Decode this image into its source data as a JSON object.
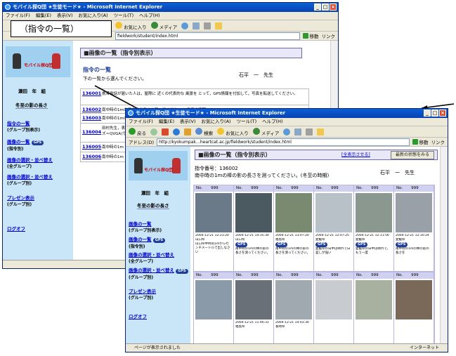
{
  "callout": {
    "label": "（指令の一覧）"
  },
  "back_window": {
    "title": "モバイル探Q団  ★生徒モード★ - Microsoft Internet Explorer",
    "menu": [
      "ファイル(F)",
      "編集(E)",
      "表示(V)",
      "お気に入り(A)",
      "ツール(T)",
      "ヘルプ(H)"
    ],
    "toolbar": {
      "favorites": "お気に入り",
      "media": "メディア"
    },
    "address": {
      "url": "fieldwork/student/index.html",
      "go": "移動",
      "links": "リンク"
    },
    "logo_text": "モバイル探Q団",
    "school": "瀬田　年　組",
    "theme": "冬至の影の長さ",
    "nav": [
      {
        "label": "指令の一覧",
        "sub": "(グループ別表示)",
        "gps": false
      },
      {
        "label": "画像の一覧",
        "sub": "(指令別)",
        "gps": true,
        "gps_label": "GPS"
      },
      {
        "label": "画像の選択・並べ替え",
        "sub": "(全グループ)",
        "gps": false
      },
      {
        "label": "画像の選択・並べ替え",
        "sub": "(グループ別)",
        "gps": false
      },
      {
        "label": "プレゼン表示",
        "sub": "(グループ別)",
        "gps": false
      },
      {
        "label": "ログオフ",
        "sub": "",
        "gps": false
      }
    ],
    "heading": "■画像の一覧（指令別表示）",
    "subheading": "指令の一覧",
    "instruction": "下の一覧から選んでください。",
    "teacher": "石平　一　先生",
    "rows": [
      {
        "id": "136001",
        "text": "携帯電話が届いた人は，屋際に 近くの代表的な 風景を とって，GPS情報を付加して，写真を転送してください。"
      },
      {
        "id": "136002",
        "text": "南中時の1mの棒の影の長さを測ってください。(冬至の時期)"
      },
      {
        "id": "136003",
        "text": "南中時の1mの棒の"
      },
      {
        "id": "136004",
        "text": "田村先生，表"
      },
      {
        "id": "136005",
        "text": "南中時の1m"
      },
      {
        "id": "136006",
        "text": "南中時の1m"
      }
    ],
    "row_extra": "ズ＝QVGA)で"
  },
  "front_window": {
    "title": "モバイル探Q団  ★生徒モード★ - Microsoft Internet Explorer",
    "menu": [
      "ファイル(F)",
      "編集(E)",
      "表示(V)",
      "お気に入り(A)",
      "ツール(T)",
      "ヘルプ(H)"
    ],
    "toolbar": {
      "back": "戻る",
      "search": "検索",
      "favorites": "お気に入り",
      "media": "メディア"
    },
    "address": {
      "label": "アドレス(D)",
      "url": "http://kyokumpak…heartcat.ac.jp/fieldwork/student/index.html",
      "go": "移動",
      "links": "リンク"
    },
    "logo_text": "モバイル探Q団",
    "school": "瀬田　年　組",
    "theme": "冬至の影の長さ",
    "nav": [
      {
        "label": "画像の一覧",
        "sub": "(グループ別表示)",
        "gps": false
      },
      {
        "label": "画像の一覧",
        "sub": "(指令別)",
        "gps": true,
        "gps_label": "GPS"
      },
      {
        "label": "画像の選択・並べ替え",
        "sub": "(全グループ)",
        "gps": false
      },
      {
        "label": "画像の選択・並べ替え",
        "sub": "(グループ別)",
        "gps": true,
        "gps_label": "GPS"
      },
      {
        "label": "プレゼン表示",
        "sub": "(グループ別)",
        "gps": false
      },
      {
        "label": "ログオフ",
        "sub": "",
        "gps": false
      }
    ],
    "heading": "■画像の一覧（指令別表示）",
    "show_all": "[全表示させる]",
    "latest_button": "最新の状態をみる",
    "order_label": "指令番号：136002",
    "order_text": "南中時の1mの棒の影の長さを測ってください。(冬至の時期)",
    "teacher": "石平　一　先生",
    "status": "ページが表示されました",
    "zone": "インターネット",
    "photos": [
      {
        "no": "No.",
        "num": "999",
        "date": "2004-12-21 12:23:20",
        "place": "山口県",
        "gps": false,
        "color": "#6a7a88",
        "caption": "山口県中時刻1mからセンチメートルで出しなさい"
      },
      {
        "no": "No.",
        "num": "999",
        "date": "2004-12-21 14:35:30",
        "place": "山口県",
        "gps": true,
        "gps_label": "GPS",
        "color": "#4a5a60",
        "caption": "南中時の1mの棒の影の長さを測ってください。"
      },
      {
        "no": "No.",
        "num": "999",
        "date": "2004-12-21 13:07:20",
        "place": "福島県",
        "gps": true,
        "gps_label": "GPS",
        "color": "#7a8a70",
        "caption": "南中時の1mの棒の影の長さを測ってください。"
      },
      {
        "no": "No.",
        "num": "999",
        "date": "2004-12-21 12:07:25",
        "place": "愛媛県",
        "gps": true,
        "gps_label": "GPS",
        "color": "#b8c0c8",
        "caption": "愛媛県の日中は晴れで日差しが強い"
      },
      {
        "no": "No.",
        "num": "999",
        "date": "2004-12-21 12:11:56",
        "place": "愛媛県",
        "gps": true,
        "gps_label": "GPS",
        "color": "#8a9890",
        "caption": "愛媛県の日中は晴れで，もう一度"
      },
      {
        "no": "No.",
        "num": "999",
        "date": "2004-12-21 12:10:24",
        "place": "愛媛県",
        "gps": true,
        "gps_label": "GPS",
        "color": "#9aa0a8",
        "caption": "南中時の1mの棒の影の長さを"
      },
      {
        "no": "No.",
        "num": "999",
        "date": "",
        "place": "",
        "gps": false,
        "color": "#8a9aa8",
        "caption": ""
      },
      {
        "no": "No.",
        "num": "999",
        "date": "2004-12-21 11:46:31",
        "place": "福島県",
        "gps": false,
        "color": "#6a7078",
        "caption": ""
      },
      {
        "no": "No.",
        "num": "999",
        "date": "2004-12-21 14:03:30",
        "place": "長崎県",
        "gps": false,
        "color": "#a0a8b0",
        "caption": ""
      },
      {
        "no": "No.",
        "num": "999",
        "date": "",
        "place": "",
        "gps": false,
        "color": "#c8ccd0",
        "caption": ""
      },
      {
        "no": "No.",
        "num": "999",
        "date": "",
        "place": "",
        "gps": false,
        "color": "#a8b0a0",
        "caption": ""
      },
      {
        "no": "No.",
        "num": "999",
        "date": "",
        "place": "",
        "gps": false,
        "color": "#7a6858",
        "caption": ""
      }
    ]
  },
  "colors": {
    "sidebar": "#c8e6f8",
    "titlebar": "#0a5fd8",
    "heading_bg": "#e8e8f8",
    "photo_header": "#d0d0f0",
    "link": "#0000cc"
  }
}
